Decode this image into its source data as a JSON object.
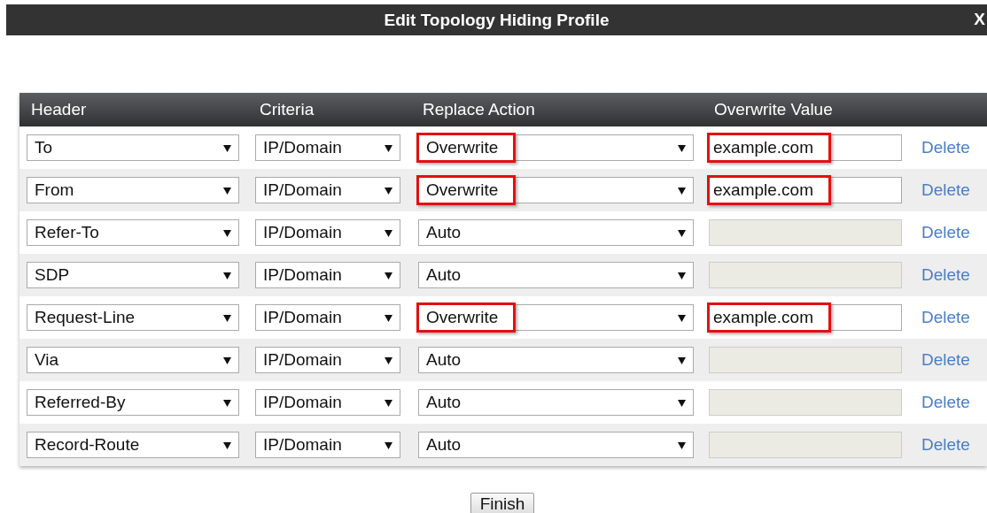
{
  "dialog": {
    "title": "Edit Topology Hiding Profile",
    "close": "X"
  },
  "table": {
    "columns": [
      "Header",
      "Criteria",
      "Replace Action",
      "Overwrite Value"
    ],
    "rows": [
      {
        "header": "To",
        "criteria": "IP/Domain",
        "action": {
          "value": "Overwrite",
          "highlighted": true
        },
        "overwrite": {
          "value": "example.com",
          "disabled": false,
          "highlighted": true
        },
        "delete": "Delete"
      },
      {
        "header": "From",
        "criteria": "IP/Domain",
        "action": {
          "value": "Overwrite",
          "highlighted": true
        },
        "overwrite": {
          "value": "example.com",
          "disabled": false,
          "highlighted": true
        },
        "delete": "Delete"
      },
      {
        "header": "Refer-To",
        "criteria": "IP/Domain",
        "action": {
          "value": "Auto",
          "highlighted": false
        },
        "overwrite": {
          "disabled": true,
          "highlighted": false
        },
        "delete": "Delete"
      },
      {
        "header": "SDP",
        "criteria": "IP/Domain",
        "action": {
          "value": "Auto",
          "highlighted": false
        },
        "overwrite": {
          "disabled": true,
          "highlighted": false
        },
        "delete": "Delete"
      },
      {
        "header": "Request-Line",
        "criteria": "IP/Domain",
        "action": {
          "value": "Overwrite",
          "highlighted": true
        },
        "overwrite": {
          "value": "example.com",
          "disabled": false,
          "highlighted": true
        },
        "delete": "Delete"
      },
      {
        "header": "Via",
        "criteria": "IP/Domain",
        "action": {
          "value": "Auto",
          "highlighted": false
        },
        "overwrite": {
          "disabled": true,
          "highlighted": false
        },
        "delete": "Delete"
      },
      {
        "header": "Referred-By",
        "criteria": "IP/Domain",
        "action": {
          "value": "Auto",
          "highlighted": false
        },
        "overwrite": {
          "disabled": true,
          "highlighted": false
        },
        "delete": "Delete"
      },
      {
        "header": "Record-Route",
        "criteria": "IP/Domain",
        "action": {
          "value": "Auto",
          "highlighted": false
        },
        "overwrite": {
          "disabled": true,
          "highlighted": false
        },
        "delete": "Delete"
      }
    ]
  },
  "finish_button": "Finish"
}
